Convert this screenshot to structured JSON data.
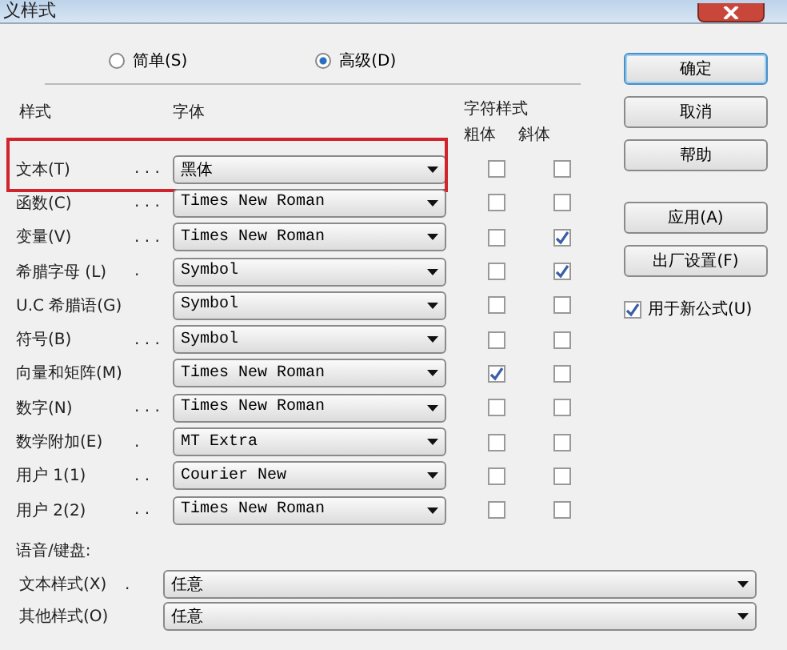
{
  "window": {
    "title": "义样式"
  },
  "mode_options": [
    {
      "label": "简单(S)",
      "selected": false
    },
    {
      "label": "高级(D)",
      "selected": true
    }
  ],
  "headers": {
    "style": "样式",
    "font": "字体",
    "char_style": "字符样式",
    "bold": "粗体",
    "italic": "斜体"
  },
  "rows": [
    {
      "label": "文本(T)",
      "dots": ". . .",
      "font": "黑体",
      "bold": false,
      "italic": false,
      "highlighted": true
    },
    {
      "label": "函数(C)",
      "dots": ". . .",
      "font": "Times New Roman",
      "bold": false,
      "italic": false,
      "highlighted": false
    },
    {
      "label": "变量(V)",
      "dots": ". . .",
      "font": "Times New Roman",
      "bold": false,
      "italic": true,
      "highlighted": false
    },
    {
      "label": "希腊字母 (L)",
      "dots": ".",
      "font": "Symbol",
      "bold": false,
      "italic": true,
      "highlighted": false
    },
    {
      "label": "U.C 希腊语(G)",
      "font": "Symbol",
      "bold": false,
      "italic": false,
      "highlighted": false
    },
    {
      "label": "符号(B)",
      "dots": ". . .",
      "font": "Symbol",
      "bold": false,
      "italic": false,
      "highlighted": false
    },
    {
      "label": "向量和矩阵(M)",
      "font": "Times New Roman",
      "bold": true,
      "italic": false,
      "highlighted": false
    },
    {
      "label": "数字(N)",
      "dots": ". . .",
      "font": "Times New Roman",
      "bold": false,
      "italic": false,
      "highlighted": false
    },
    {
      "label": "数学附加(E)",
      "dots": ".",
      "font": "MT Extra",
      "bold": false,
      "italic": false,
      "highlighted": false
    },
    {
      "label": "用户 1(1)",
      "dots": ". .",
      "font": "Courier New",
      "bold": false,
      "italic": false,
      "highlighted": false
    },
    {
      "label": "用户 2(2)",
      "dots": ". .",
      "font": "Times New Roman",
      "bold": false,
      "italic": false,
      "highlighted": false
    }
  ],
  "language": {
    "heading": "语音/键盘:",
    "rows": [
      {
        "label": "文本样式(X)",
        "dots": ".",
        "value": "任意"
      },
      {
        "label": "其他样式(O)",
        "value": "任意"
      }
    ]
  },
  "buttons": [
    {
      "label": "确定",
      "default": true
    },
    {
      "label": "取消",
      "default": false
    },
    {
      "label": "帮助",
      "default": false
    },
    {
      "label": "应用(A)",
      "default": false
    },
    {
      "label": "出厂设置(F)",
      "default": false
    }
  ],
  "new_formula": {
    "label": "用于新公式(U)",
    "checked": true
  }
}
